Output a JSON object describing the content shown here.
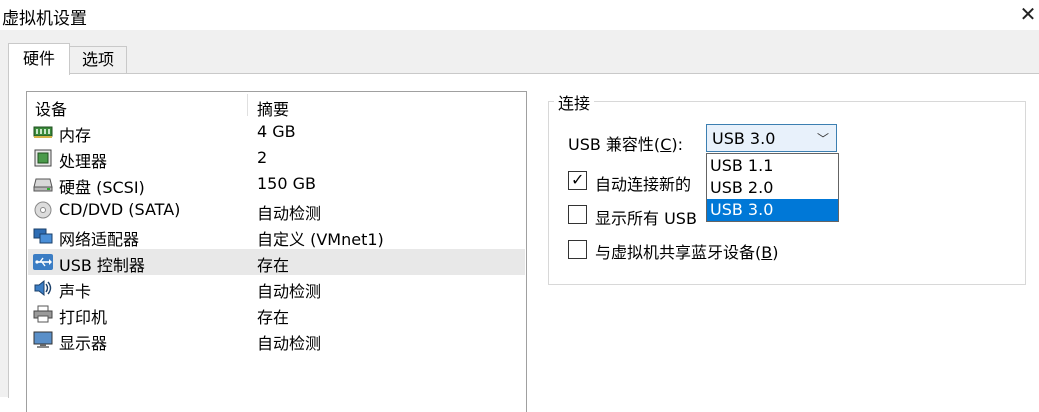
{
  "window": {
    "title": "虚拟机设置",
    "close_glyph": "✕"
  },
  "tabs": [
    {
      "label": "硬件",
      "active": true
    },
    {
      "label": "选项",
      "active": false
    }
  ],
  "device_list": {
    "headers": {
      "device": "设备",
      "summary": "摘要"
    },
    "items": [
      {
        "icon": "memory-icon",
        "name": "内存",
        "summary": "4 GB",
        "selected": false
      },
      {
        "icon": "processor-icon",
        "name": "处理器",
        "summary": "2",
        "selected": false
      },
      {
        "icon": "hard-disk-icon",
        "name": "硬盘 (SCSI)",
        "summary": "150 GB",
        "selected": false
      },
      {
        "icon": "cd-dvd-icon",
        "name": "CD/DVD (SATA)",
        "summary": "自动检测",
        "selected": false
      },
      {
        "icon": "network-adapter-icon",
        "name": "网络适配器",
        "summary": "自定义 (VMnet1)",
        "selected": false
      },
      {
        "icon": "usb-icon",
        "name": "USB 控制器",
        "summary": "存在",
        "selected": true
      },
      {
        "icon": "speaker-icon",
        "name": "声卡",
        "summary": "自动检测",
        "selected": false
      },
      {
        "icon": "printer-icon",
        "name": "打印机",
        "summary": "存在",
        "selected": false
      },
      {
        "icon": "display-icon",
        "name": "显示器",
        "summary": "自动检测",
        "selected": false
      }
    ]
  },
  "connection": {
    "group_label": "连接",
    "compat_label_pre": "USB 兼容性(",
    "compat_label_key": "C",
    "compat_label_post": "):",
    "compat_selected": "USB 3.0",
    "compat_options": [
      "USB 1.1",
      "USB 2.0",
      "USB 3.0"
    ],
    "checkboxes": [
      {
        "label": "自动连接新的",
        "checked": true
      },
      {
        "label": "显示所有 USB",
        "checked": false
      },
      {
        "label_pre": "与虚拟机共享蓝牙设备(",
        "label_key": "B",
        "label_post": ")",
        "checked": false
      }
    ]
  },
  "colors": {
    "highlight": "#0078d7",
    "selected_row": "#e8e8e8",
    "select_border": "#3c7fb1"
  }
}
